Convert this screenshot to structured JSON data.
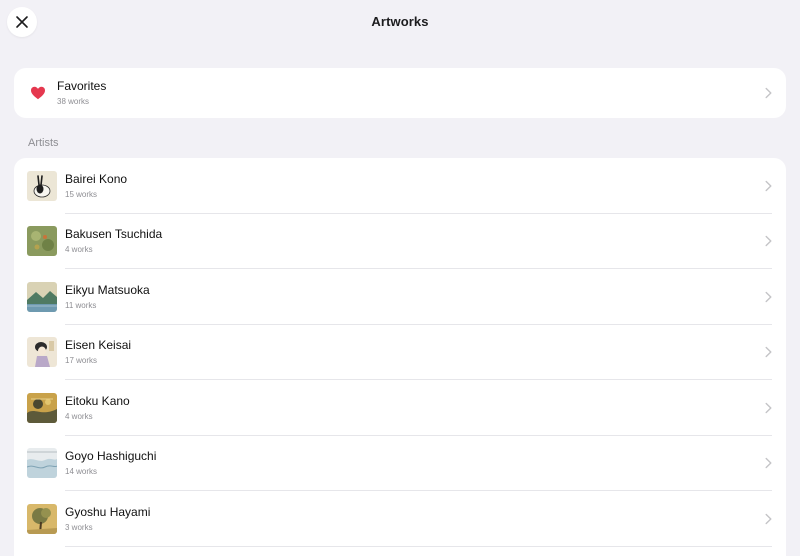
{
  "nav": {
    "title": "Artworks"
  },
  "favorites": {
    "label": "Favorites",
    "count": "38 works",
    "heart_color": "#e5384f"
  },
  "artists": {
    "header": "Artists",
    "items": [
      {
        "name": "Bairei Kono",
        "count": "15 works",
        "thumb": "rabbit-painting"
      },
      {
        "name": "Bakusen Tsuchida",
        "count": "4 works",
        "thumb": "garden-painting"
      },
      {
        "name": "Eikyu Matsuoka",
        "count": "11 works",
        "thumb": "landscape-painting"
      },
      {
        "name": "Eisen Keisai",
        "count": "17 works",
        "thumb": "portrait-print"
      },
      {
        "name": "Eitoku Kano",
        "count": "4 works",
        "thumb": "gold-screen-painting"
      },
      {
        "name": "Goyo Hashiguchi",
        "count": "14 works",
        "thumb": "wave-print"
      },
      {
        "name": "Gyoshu Hayami",
        "count": "3 works",
        "thumb": "tree-painting"
      }
    ]
  }
}
